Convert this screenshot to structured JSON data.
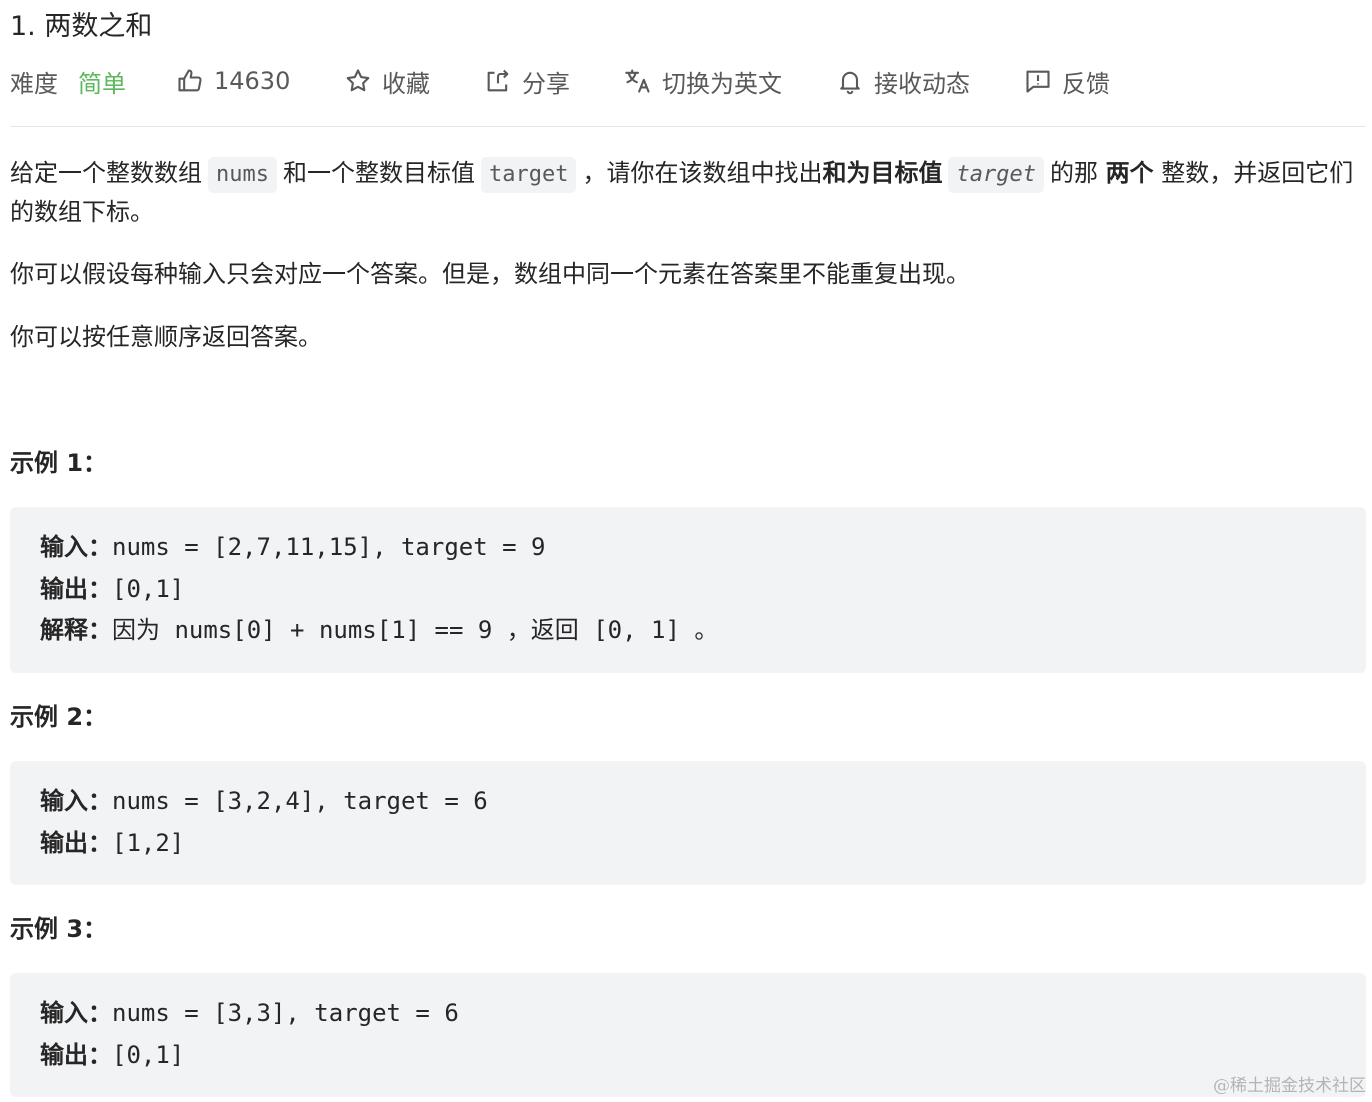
{
  "problem": {
    "title": "1. 两数之和"
  },
  "meta": {
    "difficulty_label": "难度",
    "difficulty_value": "简单",
    "likes": "14630",
    "favorite_label": "收藏",
    "share_label": "分享",
    "translate_label": "切换为英文",
    "subscribe_label": "接收动态",
    "feedback_label": "反馈"
  },
  "description": {
    "p1_a": "给定一个整数数组",
    "p1_code1": "nums",
    "p1_b": "和一个整数目标值",
    "p1_code2": "target",
    "p1_c": "，请你在该数组中找出",
    "p1_bold1": "和为目标值",
    "p1_code3": "target",
    "p1_d": "的那",
    "p1_bold2": "两个",
    "p1_e": "整数，并返回它们的数组下标。",
    "p2": "你可以假设每种输入只会对应一个答案。但是，数组中同一个元素在答案里不能重复出现。",
    "p3": "你可以按任意顺序返回答案。"
  },
  "examples": [
    {
      "title": "示例 1：",
      "input_label": "输入：",
      "input": "nums = [2,7,11,15], target = 9",
      "output_label": "输出：",
      "output": "[0,1]",
      "explain_label": "解释：",
      "explain_a": "因为",
      "explain_code": " nums[0] + nums[1] == 9 ",
      "explain_b": "，返回",
      "explain_code2": " [0, 1] ",
      "explain_c": "。"
    },
    {
      "title": "示例 2：",
      "input_label": "输入：",
      "input": "nums = [3,2,4], target = 6",
      "output_label": "输出：",
      "output": "[1,2]"
    },
    {
      "title": "示例 3：",
      "input_label": "输入：",
      "input": "nums = [3,3], target = 6",
      "output_label": "输出：",
      "output": "[0,1]"
    }
  ],
  "watermark": "@稀土掘金技术社区",
  "icons": {
    "like": "thumbs-up-icon",
    "favorite": "star-icon",
    "share": "share-icon",
    "translate": "translate-icon",
    "subscribe": "bell-icon",
    "feedback": "feedback-icon"
  },
  "colors": {
    "difficulty_easy": "#5cb85c",
    "code_bg": "#f2f3f5",
    "text": "#262626",
    "muted": "#595959"
  }
}
